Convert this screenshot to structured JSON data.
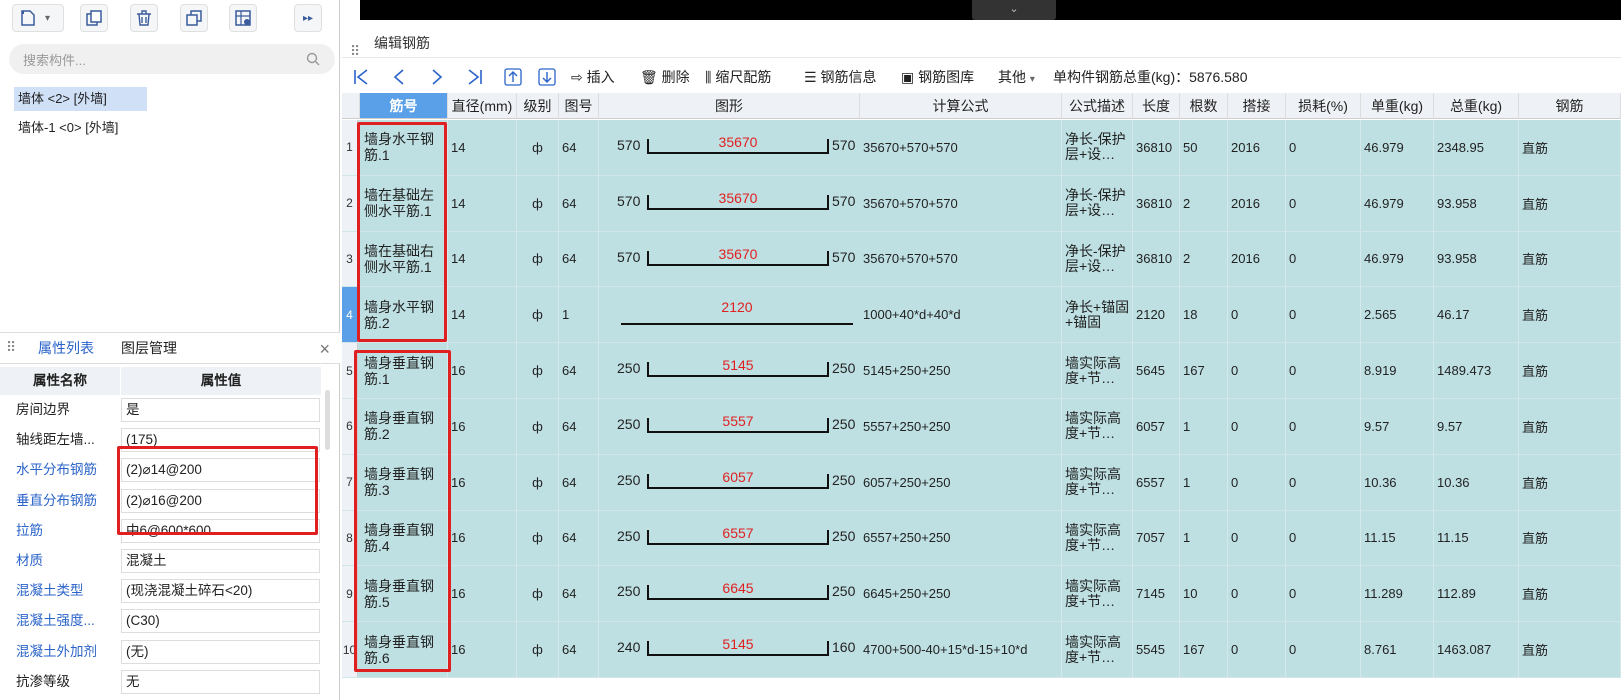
{
  "left_panel": {
    "toolbar_buttons": [
      "new-doc-icon",
      "dropdown-icon",
      "copy-icon",
      "delete-icon",
      "duplicate-icon",
      "layer-copy-icon",
      "expand-icon"
    ],
    "search_placeholder": "搜索构件...",
    "tree_items": [
      {
        "label": "墙体 <2> [外墙]",
        "selected": true
      },
      {
        "label": "墙体-1 <0> [外墙]",
        "selected": false
      }
    ],
    "tabs": [
      {
        "label": "属性列表",
        "active": true
      },
      {
        "label": "图层管理",
        "active": false
      }
    ],
    "prop_headers": {
      "name": "属性名称",
      "value": "属性值"
    },
    "properties": [
      {
        "name": "房间边界",
        "value": "是",
        "blue": false
      },
      {
        "name": "轴线距左墙...",
        "value": "(175)",
        "blue": false
      },
      {
        "name": "水平分布钢筋",
        "value": "(2)⌀14@200",
        "blue": true
      },
      {
        "name": "垂直分布钢筋",
        "value": "(2)⌀16@200",
        "blue": true
      },
      {
        "name": "拉筋",
        "value": "中6@600*600",
        "blue": true
      },
      {
        "name": "材质",
        "value": "混凝土",
        "blue": true
      },
      {
        "name": "混凝土类型",
        "value": "(现浇混凝土碎石<20)",
        "blue": true
      },
      {
        "name": "混凝土强度...",
        "value": "(C30)",
        "blue": true
      },
      {
        "name": "混凝土外加剂",
        "value": "(无)",
        "blue": true
      },
      {
        "name": "抗渗等级",
        "value": "无",
        "blue": false
      }
    ]
  },
  "editor": {
    "title": "编辑钢筋",
    "toolbar": {
      "insert": "插入",
      "delete": "删除",
      "scale": "缩尺配筋",
      "info": "钢筋信息",
      "library": "钢筋图库",
      "other": "其他",
      "total_label": "单构件钢筋总重(kg)：5876.580"
    },
    "columns": [
      "筋号",
      "直径(mm)",
      "级别",
      "图号",
      "图形",
      "计算公式",
      "公式描述",
      "长度",
      "根数",
      "搭接",
      "损耗(%)",
      "单重(kg)",
      "总重(kg)",
      "钢筋"
    ],
    "rows": [
      {
        "no": "1",
        "name": "墙身水平钢筋.1",
        "dia": "14",
        "grade": "ф",
        "fig": "64",
        "left": "570",
        "mid": "35670",
        "right": "570",
        "formula": "35670+570+570",
        "desc": "净长-保护层+设…",
        "len": "36810",
        "count": "50",
        "lap": "2016",
        "loss": "0",
        "unit": "46.979",
        "total": "2348.95",
        "type": "直筋",
        "shape": "u"
      },
      {
        "no": "2",
        "name": "墙在基础左侧水平筋.1",
        "dia": "14",
        "grade": "ф",
        "fig": "64",
        "left": "570",
        "mid": "35670",
        "right": "570",
        "formula": "35670+570+570",
        "desc": "净长-保护层+设…",
        "len": "36810",
        "count": "2",
        "lap": "2016",
        "loss": "0",
        "unit": "46.979",
        "total": "93.958",
        "type": "直筋",
        "shape": "u"
      },
      {
        "no": "3",
        "name": "墙在基础右侧水平筋.1",
        "dia": "14",
        "grade": "ф",
        "fig": "64",
        "left": "570",
        "mid": "35670",
        "right": "570",
        "formula": "35670+570+570",
        "desc": "净长-保护层+设…",
        "len": "36810",
        "count": "2",
        "lap": "2016",
        "loss": "0",
        "unit": "46.979",
        "total": "93.958",
        "type": "直筋",
        "shape": "u"
      },
      {
        "no": "4",
        "name": "墙身水平钢筋.2",
        "dia": "14",
        "grade": "ф",
        "fig": "1",
        "left": "",
        "mid": "2120",
        "right": "",
        "formula": "1000+40*d+40*d",
        "desc": "净长+锚固+锚固",
        "len": "2120",
        "count": "18",
        "lap": "0",
        "loss": "0",
        "unit": "2.565",
        "total": "46.17",
        "type": "直筋",
        "shape": "flat"
      },
      {
        "no": "5",
        "name": "墙身垂直钢筋.1",
        "dia": "16",
        "grade": "ф",
        "fig": "64",
        "left": "250",
        "mid": "5145",
        "right": "250",
        "formula": "5145+250+250",
        "desc": "墙实际高度+节…",
        "len": "5645",
        "count": "167",
        "lap": "0",
        "loss": "0",
        "unit": "8.919",
        "total": "1489.473",
        "type": "直筋",
        "shape": "u"
      },
      {
        "no": "6",
        "name": "墙身垂直钢筋.2",
        "dia": "16",
        "grade": "ф",
        "fig": "64",
        "left": "250",
        "mid": "5557",
        "right": "250",
        "formula": "5557+250+250",
        "desc": "墙实际高度+节…",
        "len": "6057",
        "count": "1",
        "lap": "0",
        "loss": "0",
        "unit": "9.57",
        "total": "9.57",
        "type": "直筋",
        "shape": "u"
      },
      {
        "no": "7",
        "name": "墙身垂直钢筋.3",
        "dia": "16",
        "grade": "ф",
        "fig": "64",
        "left": "250",
        "mid": "6057",
        "right": "250",
        "formula": "6057+250+250",
        "desc": "墙实际高度+节…",
        "len": "6557",
        "count": "1",
        "lap": "0",
        "loss": "0",
        "unit": "10.36",
        "total": "10.36",
        "type": "直筋",
        "shape": "u"
      },
      {
        "no": "8",
        "name": "墙身垂直钢筋.4",
        "dia": "16",
        "grade": "ф",
        "fig": "64",
        "left": "250",
        "mid": "6557",
        "right": "250",
        "formula": "6557+250+250",
        "desc": "墙实际高度+节…",
        "len": "7057",
        "count": "1",
        "lap": "0",
        "loss": "0",
        "unit": "11.15",
        "total": "11.15",
        "type": "直筋",
        "shape": "u"
      },
      {
        "no": "9",
        "name": "墙身垂直钢筋.5",
        "dia": "16",
        "grade": "ф",
        "fig": "64",
        "left": "250",
        "mid": "6645",
        "right": "250",
        "formula": "6645+250+250",
        "desc": "墙实际高度+节…",
        "len": "7145",
        "count": "10",
        "lap": "0",
        "loss": "0",
        "unit": "11.289",
        "total": "112.89",
        "type": "直筋",
        "shape": "u"
      },
      {
        "no": "10",
        "name": "墙身垂直钢筋.6",
        "dia": "16",
        "grade": "ф",
        "fig": "64",
        "left": "240",
        "mid": "5145",
        "right": "160",
        "formula": "4700+500-40+15*d-15+10*d",
        "desc": "墙实际高度+节…",
        "len": "5545",
        "count": "167",
        "lap": "0",
        "loss": "0",
        "unit": "8.761",
        "total": "1463.087",
        "type": "直筋",
        "shape": "u"
      }
    ]
  }
}
